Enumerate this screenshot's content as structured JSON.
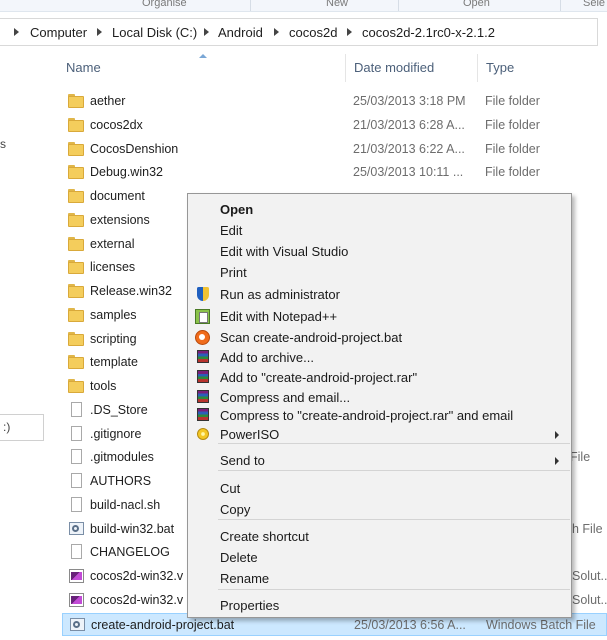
{
  "ribbon": {
    "organise": "Organise",
    "new": "New",
    "open": "Open",
    "select": "Sele"
  },
  "breadcrumb": [
    "Computer",
    "Local Disk (C:)",
    "Android",
    "cocos2d",
    "cocos2d-2.1rc0-x-2.1.2"
  ],
  "nav": {
    "frag_s": "s",
    "frag_box": ":)"
  },
  "columns": {
    "name": "Name",
    "date": "Date modified",
    "type": "Type"
  },
  "files": [
    {
      "name": "aether",
      "date": "25/03/2013 3:18 PM",
      "type": "File folder",
      "icon": "folder-icon"
    },
    {
      "name": "cocos2dx",
      "date": "21/03/2013 6:28 A...",
      "type": "File folder",
      "icon": "folder-icon"
    },
    {
      "name": "CocosDenshion",
      "date": "21/03/2013 6:22 A...",
      "type": "File folder",
      "icon": "folder-icon"
    },
    {
      "name": "Debug.win32",
      "date": "25/03/2013 10:11 ...",
      "type": "File folder",
      "icon": "folder-icon"
    },
    {
      "name": "document",
      "date": "",
      "type": "",
      "icon": "folder-icon"
    },
    {
      "name": "extensions",
      "date": "",
      "type": "",
      "icon": "folder-icon"
    },
    {
      "name": "external",
      "date": "",
      "type": "",
      "icon": "folder-icon"
    },
    {
      "name": "licenses",
      "date": "",
      "type": "",
      "icon": "folder-icon"
    },
    {
      "name": "Release.win32",
      "date": "",
      "type": "",
      "icon": "folder-icon"
    },
    {
      "name": "samples",
      "date": "",
      "type": "",
      "icon": "folder-icon"
    },
    {
      "name": "scripting",
      "date": "",
      "type": "",
      "icon": "folder-icon"
    },
    {
      "name": "template",
      "date": "",
      "type": "",
      "icon": "folder-icon"
    },
    {
      "name": "tools",
      "date": "",
      "type": "",
      "icon": "folder-icon"
    },
    {
      "name": ".DS_Store",
      "date": "",
      "type": "",
      "icon": "file-icon"
    },
    {
      "name": ".gitignore",
      "date": "",
      "type": "",
      "icon": "file-icon"
    },
    {
      "name": ".gitmodules",
      "date": "",
      "type": "File",
      "icon": "file-icon"
    },
    {
      "name": "AUTHORS",
      "date": "",
      "type": "",
      "icon": "file-icon"
    },
    {
      "name": "build-nacl.sh",
      "date": "",
      "type": "",
      "icon": "file-icon"
    },
    {
      "name": "build-win32.bat",
      "date": "",
      "type": "h File",
      "icon": "batch-file-icon"
    },
    {
      "name": "CHANGELOG",
      "date": "",
      "type": "",
      "icon": "file-icon"
    },
    {
      "name": "cocos2d-win32.v",
      "date": "",
      "type": "Solut...",
      "icon": "visual-studio-solution-icon"
    },
    {
      "name": "cocos2d-win32.v",
      "date": "",
      "type": "Solut...",
      "icon": "visual-studio-solution-icon"
    },
    {
      "name": "create-android-project.bat",
      "date": "25/03/2013 6:56 A...",
      "type": "Windows Batch File",
      "icon": "batch-file-icon"
    }
  ],
  "context_menu": {
    "items": [
      {
        "label": "Open",
        "bold": true,
        "icon": ""
      },
      {
        "label": "Edit",
        "icon": ""
      },
      {
        "label": "Edit with Visual Studio",
        "icon": ""
      },
      {
        "label": "Print",
        "icon": ""
      },
      {
        "label": "Run as administrator",
        "icon": "uac-shield-icon"
      },
      {
        "label": "Edit with Notepad++",
        "icon": "notepad-plus-plus-icon"
      },
      {
        "label": "Scan create-android-project.bat",
        "icon": "antivirus-scan-icon"
      },
      {
        "label": "Add to archive...",
        "icon": "winrar-icon"
      },
      {
        "label": "Add to \"create-android-project.rar\"",
        "icon": "winrar-icon"
      },
      {
        "label": "Compress and email...",
        "icon": "winrar-icon"
      },
      {
        "label": "Compress to \"create-android-project.rar\" and email",
        "icon": "winrar-icon"
      },
      {
        "label": "PowerISO",
        "icon": "poweriso-icon",
        "submenu": true
      },
      {
        "label": "Send to",
        "icon": "",
        "submenu": true
      },
      {
        "label": "Cut",
        "icon": ""
      },
      {
        "label": "Copy",
        "icon": ""
      },
      {
        "label": "Create shortcut",
        "icon": ""
      },
      {
        "label": "Delete",
        "icon": ""
      },
      {
        "label": "Rename",
        "icon": ""
      },
      {
        "label": "Properties",
        "icon": ""
      }
    ]
  },
  "colors": {
    "selection_bg": "#cce8ff",
    "selection_border": "#99d1ff",
    "header_text": "#4c607a",
    "menu_bg": "#f2f2f2"
  }
}
